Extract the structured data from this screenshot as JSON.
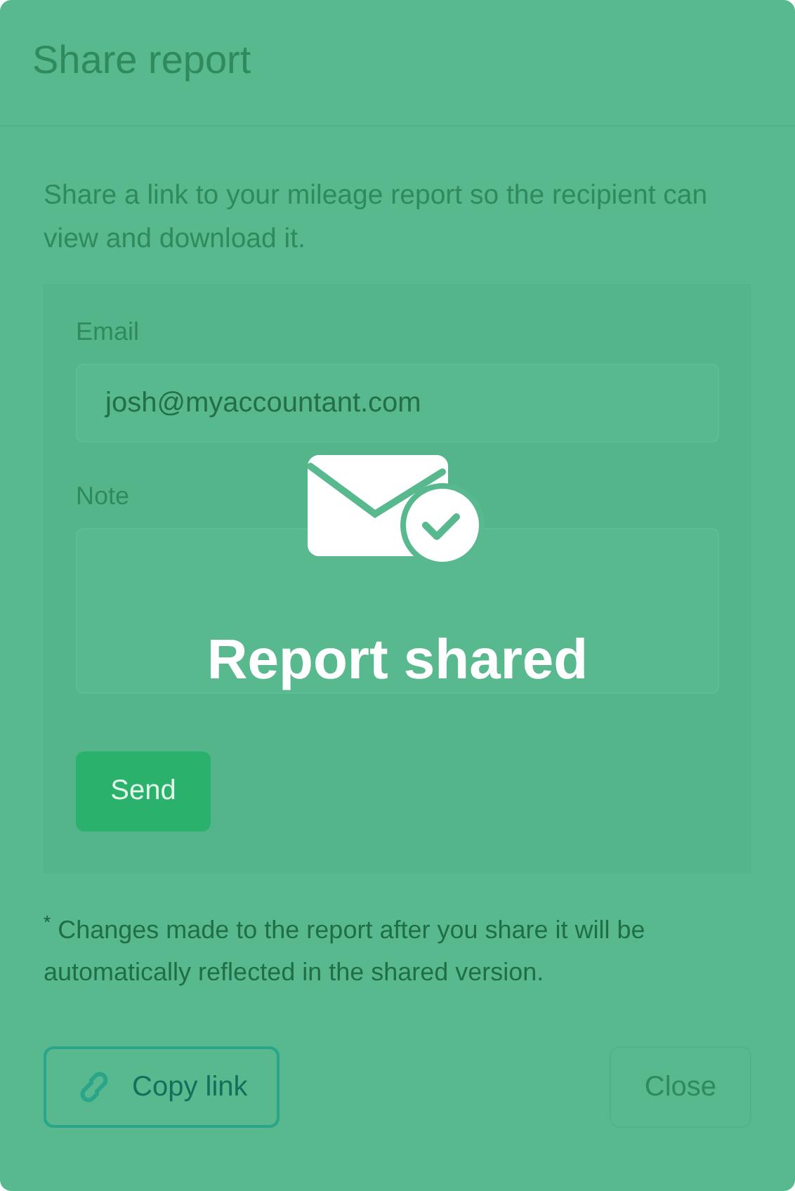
{
  "dialog": {
    "title": "Share report",
    "description": "Share a link to your mileage report so the recipient can view and download it.",
    "form": {
      "fields": [
        {
          "kind": "input",
          "label": "Email",
          "value": "josh@myaccountant.com"
        },
        {
          "kind": "textarea",
          "label": "Note"
        }
      ],
      "send_button": "Send"
    },
    "footnote": "$^{*}$ Changes made to the report after you share it will be automatically reflected in the shared version.",
    "copy_link_button": "Copy link",
    "close_button": "Close"
  },
  "overlay": {
    "message": "Report shared"
  }
}
